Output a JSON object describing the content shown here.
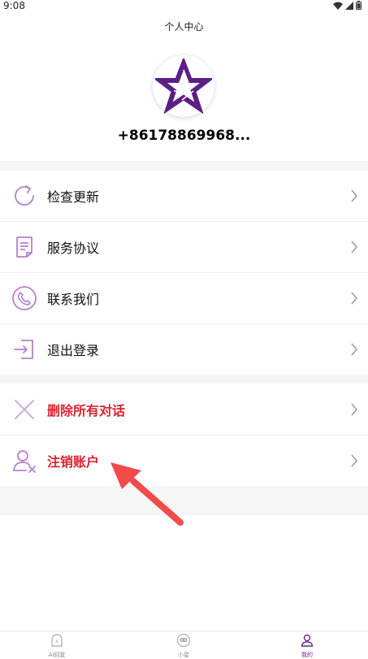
{
  "status": {
    "time": "9:08"
  },
  "header": {
    "title": "个人中心"
  },
  "profile": {
    "username": "+86178869968..."
  },
  "menu_group1": [
    {
      "label": "检查更新",
      "icon": "refresh-icon"
    },
    {
      "label": "服务协议",
      "icon": "document-icon"
    },
    {
      "label": "联系我们",
      "icon": "phone-icon"
    },
    {
      "label": "退出登录",
      "icon": "logout-icon"
    }
  ],
  "menu_group2": [
    {
      "label": "删除所有对话",
      "icon": "close-x-icon"
    },
    {
      "label": "注销账户",
      "icon": "user-remove-icon"
    }
  ],
  "tabs": [
    {
      "label": "AI回复",
      "icon": "ai-reply-icon"
    },
    {
      "label": "小星",
      "icon": "robot-face-icon"
    },
    {
      "label": "我的",
      "icon": "user-icon",
      "active": true
    }
  ],
  "colors": {
    "accent": "#6a2a8a",
    "icon": "#b77fcf",
    "danger": "#d9232f",
    "arrow": "#f04a4a"
  }
}
